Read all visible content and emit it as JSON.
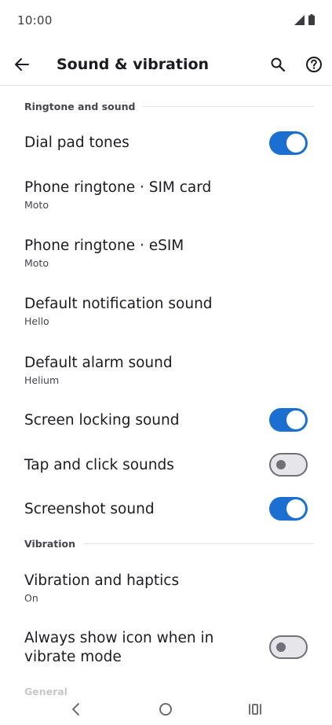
{
  "status": {
    "time": "10:00"
  },
  "app_bar": {
    "title": "Sound & vibration"
  },
  "sections": {
    "ringtone": {
      "header": "Ringtone and sound"
    },
    "vibration": {
      "header": "Vibration"
    },
    "general": {
      "header": "General"
    }
  },
  "items": {
    "dial_pad_tones": {
      "title": "Dial pad tones",
      "toggle": true
    },
    "phone_ringtone_sim": {
      "title": "Phone ringtone · SIM card",
      "subtitle": "Moto"
    },
    "phone_ringtone_esim": {
      "title": "Phone ringtone · eSIM",
      "subtitle": "Moto"
    },
    "default_notification": {
      "title": "Default notification sound",
      "subtitle": "Hello"
    },
    "default_alarm": {
      "title": "Default alarm sound",
      "subtitle": "Helium"
    },
    "screen_locking": {
      "title": "Screen locking sound",
      "toggle": true
    },
    "tap_click": {
      "title": "Tap and click sounds",
      "toggle": false
    },
    "screenshot": {
      "title": "Screenshot sound",
      "toggle": true
    },
    "vibration_haptics": {
      "title": "Vibration and haptics",
      "subtitle": "On"
    },
    "always_show_icon": {
      "title_line1": "Always show icon when in",
      "title_line2": "vibrate mode",
      "toggle": false
    }
  },
  "icons": {
    "back": "arrow-left-icon",
    "search": "search-icon",
    "help": "help-circle-icon",
    "signal": "signal-icon",
    "battery": "battery-icon",
    "nav_back": "chevron-left-icon",
    "nav_home": "circle-home-icon",
    "nav_recents": "recents-icon"
  },
  "colors": {
    "accent": "#1a6fd0",
    "switch_off_track": "#e5e5ea",
    "switch_off_border": "#6f7078"
  }
}
